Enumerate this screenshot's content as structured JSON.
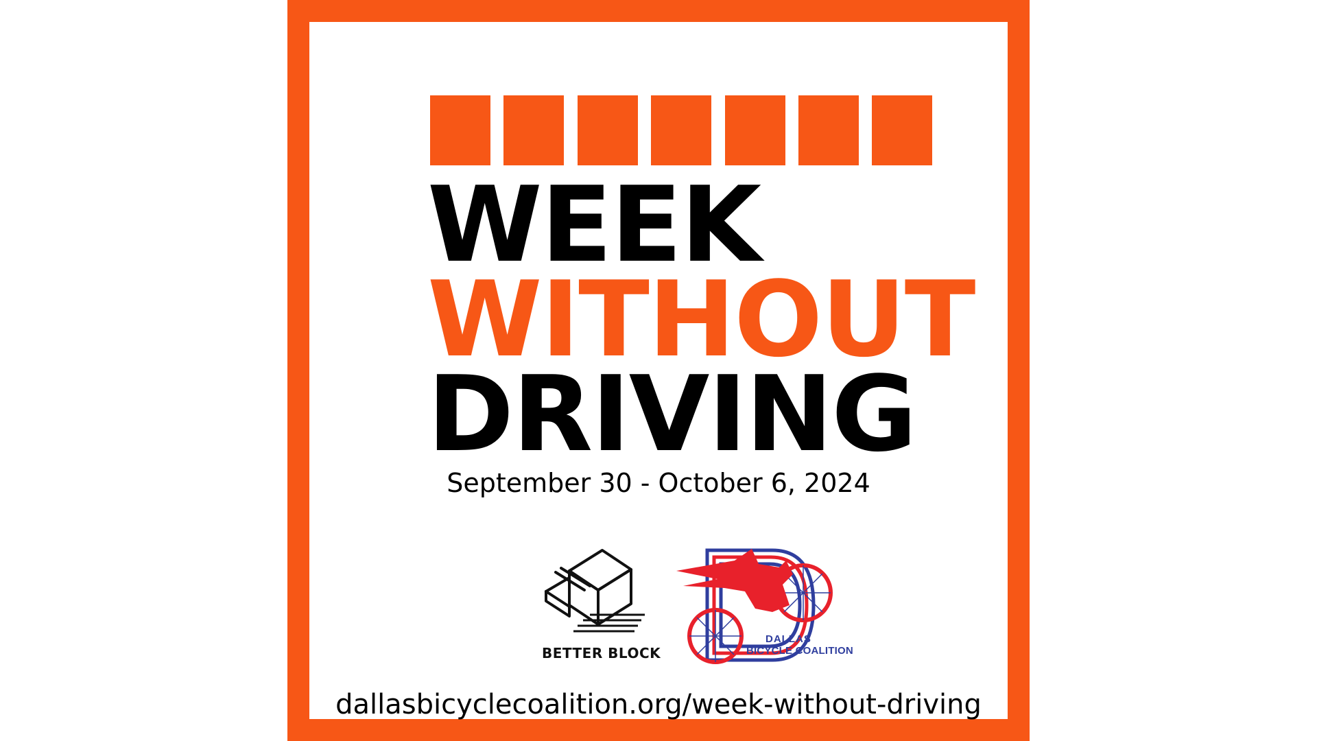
{
  "poster": {
    "headline": {
      "line1": "WEEK",
      "line2": "WITHOUT",
      "line3": "DRIVING"
    },
    "dates": "September 30 - October 6, 2024",
    "url": "dallasbicyclecoalition.org/week-without-driving",
    "square_count": 7,
    "logos": {
      "better_block": {
        "icon": "better-block-icon",
        "label": "BETTER BLOCK"
      },
      "dallas_bicycle_coalition": {
        "icon": "dallas-bicycle-coalition-icon",
        "label_line1": "DALLAS",
        "label_line2": "BICYCLE COALITION"
      }
    }
  },
  "colors": {
    "accent_orange": "#F75716",
    "text_black": "#000000",
    "logo_red": "#E8212B",
    "logo_blue": "#2F3E9E",
    "background": "#FFFFFF"
  }
}
